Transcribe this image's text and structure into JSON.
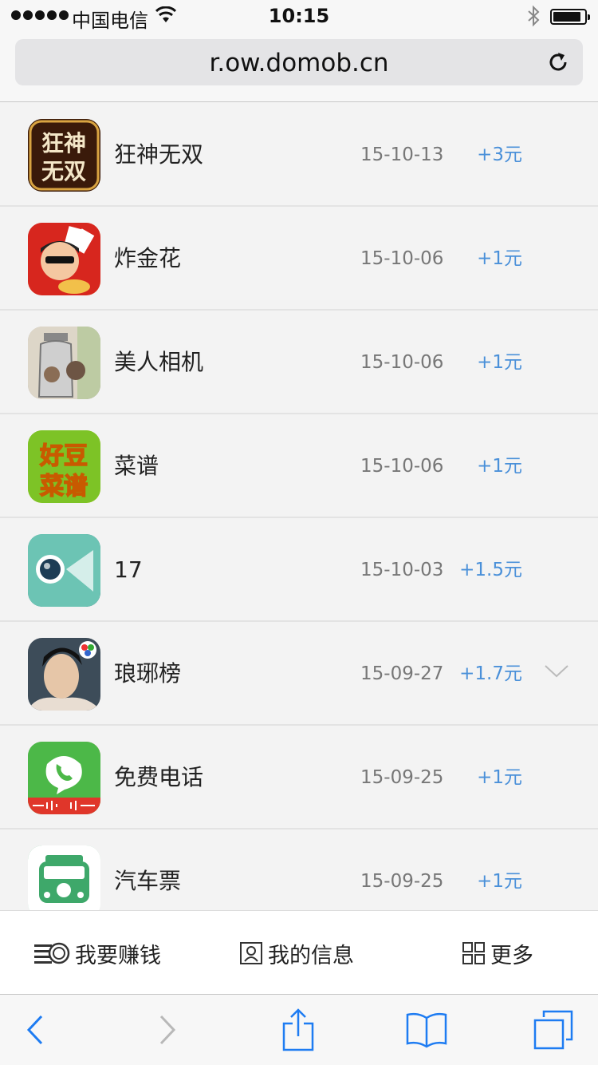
{
  "status": {
    "carrier": "中国电信",
    "time": "10:15"
  },
  "browser": {
    "url": "r.ow.domob.cn"
  },
  "apps": [
    {
      "name": "狂神无双",
      "date": "15-10-13",
      "reward": "+3元",
      "icon_text": "狂神\n无双",
      "icon": "game-icon",
      "colors": [
        "#3a1a0a",
        "#d9a441"
      ]
    },
    {
      "name": "炸金花",
      "date": "15-10-06",
      "reward": "+1元",
      "icon_text": "",
      "icon": "poker-avatar-icon",
      "colors": [
        "#d7261e",
        "#f2c04a"
      ]
    },
    {
      "name": "美人相机",
      "date": "15-10-06",
      "reward": "+1元",
      "icon_text": "",
      "icon": "camera-photo-icon",
      "colors": [
        "#c9c2b4",
        "#6d6255"
      ]
    },
    {
      "name": "菜谱",
      "date": "15-10-06",
      "reward": "+1元",
      "icon_text": "好豆\n菜谱",
      "icon": "recipe-icon",
      "colors": [
        "#7dc326",
        "#f5d90a"
      ]
    },
    {
      "name": "17",
      "date": "15-10-03",
      "reward": "+1.5元",
      "icon_text": "",
      "icon": "live-camera-icon",
      "colors": [
        "#6cc4b4",
        "#1d3c55"
      ]
    },
    {
      "name": "琅琊榜",
      "date": "15-09-27",
      "reward": "+1.7元",
      "icon_text": "",
      "icon": "drama-portrait-icon",
      "colors": [
        "#2a3b4a",
        "#e8ddd2"
      ]
    },
    {
      "name": "免费电话",
      "date": "15-09-25",
      "reward": "+1元",
      "icon_text": "",
      "icon": "phone-call-icon",
      "colors": [
        "#4cb848",
        "#e0362a"
      ]
    },
    {
      "name": "汽车票",
      "date": "15-09-25",
      "reward": "+1元",
      "icon_text": "",
      "icon": "bus-ticket-icon",
      "colors": [
        "#3ea86a",
        "#ffffff"
      ]
    }
  ],
  "tabs": [
    {
      "label": "我要赚钱",
      "icon": "earn-money-icon"
    },
    {
      "label": "我的信息",
      "icon": "profile-icon"
    },
    {
      "label": "更多",
      "icon": "grid-more-icon"
    }
  ],
  "colors": {
    "accent": "#4a90d9",
    "safari_blue": "#1e7cf2"
  }
}
